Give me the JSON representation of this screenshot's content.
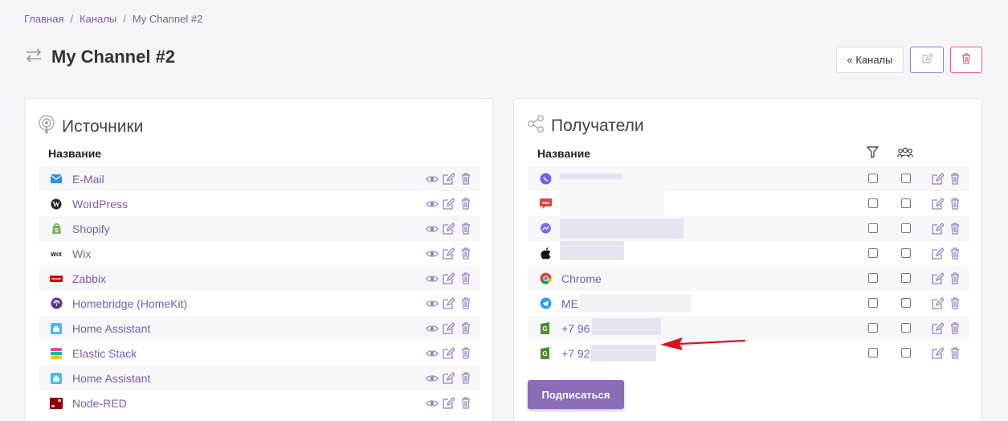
{
  "breadcrumb": {
    "home": "Главная",
    "channels": "Каналы",
    "current": "My Channel #2"
  },
  "header": {
    "title": "My Channel #2"
  },
  "actions": {
    "back_label": "« Каналы"
  },
  "sources": {
    "title": "Источники",
    "column_name": "Название",
    "items": [
      {
        "label": "E-Mail",
        "icon": "email-icon"
      },
      {
        "label": "WordPress",
        "icon": "wordpress-icon"
      },
      {
        "label": "Shopify",
        "icon": "shopify-icon"
      },
      {
        "label": "Wix",
        "icon": "wix-icon"
      },
      {
        "label": "Zabbix",
        "icon": "zabbix-icon"
      },
      {
        "label": "Homebridge (HomeKit)",
        "icon": "homebridge-icon"
      },
      {
        "label": "Home Assistant",
        "icon": "home-assistant-icon"
      },
      {
        "label": "Elastic Stack",
        "icon": "elastic-icon"
      },
      {
        "label": "Home Assistant",
        "icon": "home-assistant-icon"
      },
      {
        "label": "Node-RED",
        "icon": "node-red-icon"
      }
    ]
  },
  "recipients": {
    "title": "Получатели",
    "column_name": "Название",
    "items": [
      {
        "label": "",
        "icon": "viber-icon"
      },
      {
        "label": "",
        "icon": "sms-icon"
      },
      {
        "label": "",
        "icon": "messenger-icon"
      },
      {
        "label": "",
        "icon": "apple-icon"
      },
      {
        "label": "Chrome",
        "icon": "chrome-icon"
      },
      {
        "label": "ME",
        "icon": "telegram-icon"
      },
      {
        "label": "+7 96",
        "icon": "sms-g-icon"
      },
      {
        "label": "+7 92",
        "icon": "sms-g-icon"
      }
    ],
    "subscribe_label": "Подписаться"
  },
  "colors": {
    "accent": "#7b5cab",
    "button": "#8a6cb8",
    "danger": "#e05a8c",
    "arrow": "#e0101a"
  }
}
